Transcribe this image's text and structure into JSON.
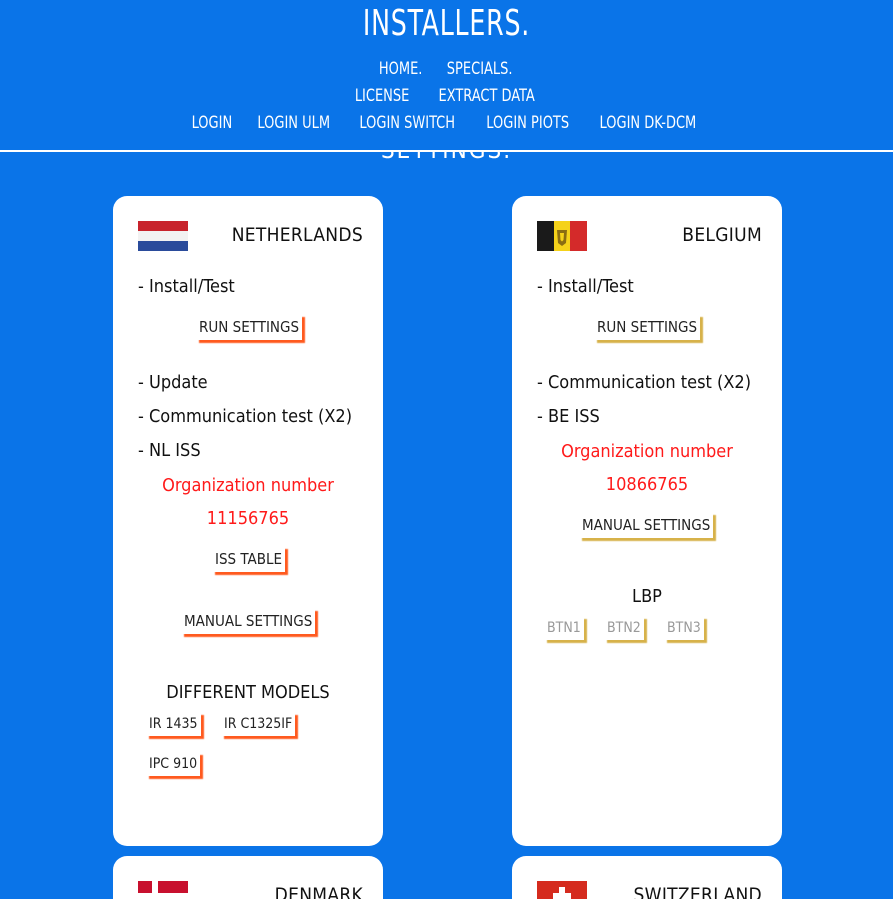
{
  "header": {
    "title": "INSTALLERS.",
    "nav_row1": [
      "HOME.",
      "SPECIALS."
    ],
    "nav_row2": [
      "LICENSE",
      "EXTRACT DATA"
    ],
    "nav_row3": [
      "LOGIN",
      "LOGIN ULM",
      "LOGIN SWITCH",
      "LOGIN PIOTS",
      "LOGIN DK-DCM"
    ],
    "section_peek": "SETTINGS."
  },
  "cards": {
    "netherlands": {
      "country": "NETHERLANDS",
      "install_test": "- Install/Test",
      "run_settings": "RUN SETTINGS",
      "update": "- Update",
      "comm_test": "- Communication test (X2)",
      "iss": "- NL ISS",
      "org_label": "Organization number",
      "org_number": "11156765",
      "iss_table": "ISS TABLE",
      "manual_settings": "MANUAL SETTINGS",
      "models_heading": "DIFFERENT MODELS",
      "models": [
        "IR 1435",
        "IR C1325IF",
        "IPC 910"
      ]
    },
    "belgium": {
      "country": "BELGIUM",
      "install_test": "- Install/Test",
      "run_settings": "RUN SETTINGS",
      "comm_test": "- Communication test (X2)",
      "iss": "- BE ISS",
      "org_label": "Organization number",
      "org_number": "10866765",
      "manual_settings": "MANUAL SETTINGS",
      "lbp_heading": "LBP",
      "lbp_buttons": [
        "BTN1",
        "BTN2",
        "BTN3"
      ]
    },
    "denmark": {
      "country": "DENMARK"
    },
    "switzerland": {
      "country": "SWITZERLAND"
    }
  },
  "colors": {
    "background": "#0a74e8",
    "accent_orange": "#ff5a1f",
    "accent_gold": "#d7b24a",
    "org_red": "#ff1a1a"
  },
  "icons": {
    "netherlands_flag": "netherlands-flag-icon",
    "belgium_flag": "belgium-flag-icon",
    "denmark_flag": "denmark-flag-icon",
    "switzerland_flag": "switzerland-flag-icon"
  }
}
